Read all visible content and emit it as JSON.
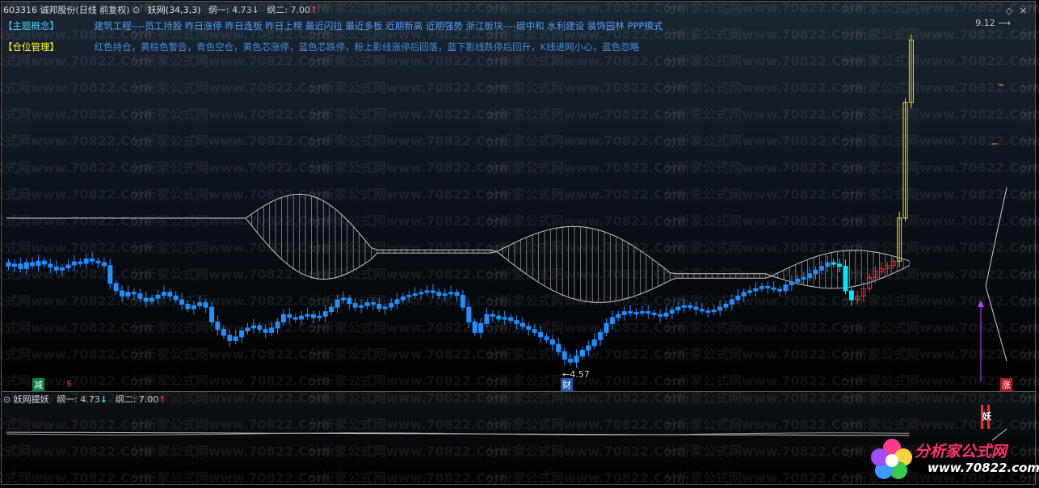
{
  "header": {
    "stock": "603316 诚邦股份(日线 前复权)",
    "indicator": "妖网(34,3,3)",
    "gang1": "纲一: 4.73",
    "gang1_arrow": "↓",
    "gang2": "纲二: 7.00",
    "gang2_arrow": "↑"
  },
  "info": {
    "theme_tag": "【主题概念】",
    "theme_text": "建筑工程----员工持股 昨日涨停 昨日连板 昨日上榜 最近闪拉 最近多板 近期新高 近期强势 浙江板块----碳中和 水利建设 装饰园林 PPP模式",
    "position_tag": "【仓位管理】",
    "position_text": "红色持仓，黄棕色警告，青色空仓，黄色芯涨停，蓝色芯跌停，粉上影线涨停后回落，蓝下影线跌停后回升，K线进网小心，蓝色忽略"
  },
  "labels": {
    "price_max": "9.12",
    "price_min": "4.57",
    "marker_jian": "减",
    "marker_dollar": "$",
    "marker_cai": "财",
    "marker_zhang": "涨",
    "sub_marker": "妖"
  },
  "subpanel": {
    "name": "妖网提妖",
    "gang1": "纲一: 4.73",
    "gang1_arrow": "↓",
    "gang2": "纲二: 7.00",
    "gang2_arrow": "↑"
  },
  "watermark": "分析家公式网www.70822.Com",
  "logo": {
    "line1": "分析家公式网",
    "line2": "www.70822.com"
  },
  "colors": {
    "bg": "#000000",
    "up_candle": "#ff2a2a",
    "down_candle": "#1e90ff",
    "neutral_candle": "#00e5ff",
    "net_line": "#c8c8c8",
    "warn_candle": "#c8a060",
    "limit_up": "#ffd700"
  },
  "chart_data": {
    "type": "candlestick",
    "symbol": "603316",
    "price_max": 9.12,
    "price_min": 4.57,
    "ylim": [
      4.4,
      9.3
    ],
    "close": [
      5.95,
      5.98,
      5.92,
      6.0,
      5.96,
      6.02,
      5.98,
      5.94,
      5.9,
      5.93,
      5.97,
      6.01,
      5.99,
      6.05,
      6.02,
      6.0,
      5.96,
      5.72,
      5.62,
      5.55,
      5.6,
      5.58,
      5.52,
      5.48,
      5.52,
      5.56,
      5.6,
      5.55,
      5.5,
      5.44,
      5.38,
      5.42,
      5.46,
      5.4,
      5.2,
      5.1,
      5.02,
      4.95,
      5.0,
      5.08,
      5.12,
      5.15,
      5.1,
      5.06,
      5.12,
      5.2,
      5.3,
      5.26,
      5.24,
      5.28,
      5.3,
      5.26,
      5.28,
      5.34,
      5.4,
      5.5,
      5.52,
      5.45,
      5.4,
      5.42,
      5.46,
      5.44,
      5.38,
      5.4,
      5.45,
      5.5,
      5.54,
      5.56,
      5.58,
      5.6,
      5.62,
      5.6,
      5.56,
      5.58,
      5.6,
      5.56,
      5.4,
      5.2,
      5.06,
      5.18,
      5.3,
      5.28,
      5.24,
      5.26,
      5.22,
      5.18,
      5.14,
      5.1,
      5.06,
      5.0,
      4.96,
      4.9,
      4.8,
      4.7,
      4.66,
      4.74,
      4.82,
      4.88,
      4.96,
      5.06,
      5.18,
      5.26,
      5.3,
      5.34,
      5.32,
      5.33,
      5.34,
      5.32,
      5.3,
      5.28,
      5.32,
      5.36,
      5.4,
      5.42,
      5.4,
      5.37,
      5.35,
      5.34,
      5.36,
      5.4,
      5.44,
      5.5,
      5.55,
      5.6,
      5.62,
      5.65,
      5.68,
      5.66,
      5.64,
      5.62,
      5.7,
      5.74,
      5.78,
      5.8,
      5.85,
      5.9,
      5.95,
      6.0,
      5.98,
      5.95,
      5.62,
      5.5,
      5.55,
      5.65,
      5.8,
      5.88,
      5.92,
      5.96,
      6.02,
      6.6,
      8.16,
      9.0
    ]
  }
}
